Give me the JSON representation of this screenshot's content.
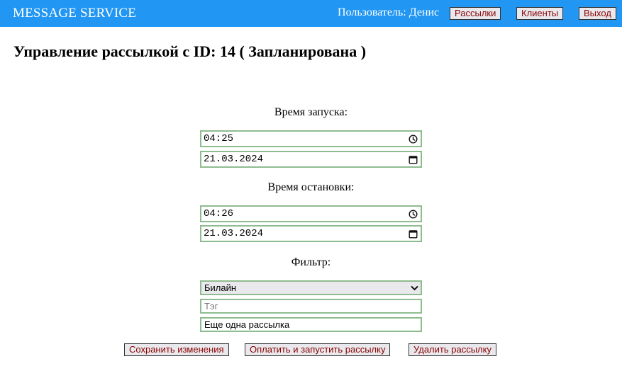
{
  "header": {
    "brand": "MESSAGE SERVICE",
    "user_text": "Пользователь: Денис",
    "nav": {
      "mailings": "Рассылки",
      "clients": "Клиенты",
      "logout": "Выход"
    }
  },
  "page": {
    "title": "Управление рассылкой с ID: 14 ( Запланирована )"
  },
  "form": {
    "start_label": "Время запуска:",
    "start_time": "04:25",
    "start_date": "21.03.2024",
    "stop_label": "Время остановки:",
    "stop_time": "04:26",
    "stop_date": "21.03.2024",
    "filter_label": "Фильтр:",
    "operator_selected": "Билайн",
    "tag_value": "",
    "tag_placeholder": "Тэг",
    "name_value": "Еще одна рассылка"
  },
  "actions": {
    "save": "Сохранить изменения",
    "pay_launch": "Оплатить и запустить рассылку",
    "delete": "Удалить рассылку"
  },
  "colors": {
    "header_bg": "#2196f3",
    "field_border": "#8fbc8f",
    "button_text": "#8b0000"
  },
  "icons": {
    "time": "clock-icon",
    "date": "calendar-icon",
    "select": "chevron-down-icon"
  }
}
